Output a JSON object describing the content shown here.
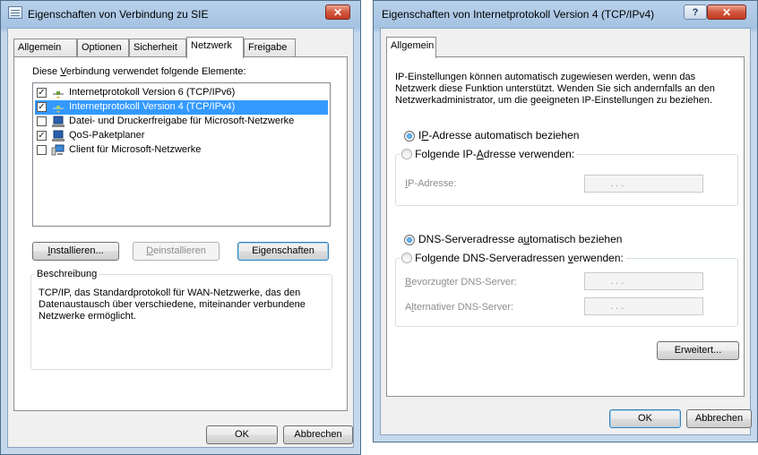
{
  "window1": {
    "title": "Eigenschaften von Verbindung zu  SIE",
    "close_glyph": "✕",
    "tabs": [
      "Allgemein",
      "Optionen",
      "Sicherheit",
      "Netzwerk",
      "Freigabe"
    ],
    "active_tab": "Netzwerk",
    "list_label_pre": "Diese ",
    "list_label_u": "V",
    "list_label_post": "erbindung verwendet folgende Elemente:",
    "items": [
      {
        "label": "Internetprotokoll Version 6 (TCP/IPv6)",
        "checked": true,
        "icon": "protocol-icon"
      },
      {
        "label": "Internetprotokoll Version 4 (TCP/IPv4)",
        "checked": true,
        "icon": "protocol-icon",
        "selected": true
      },
      {
        "label": "Datei- und Druckerfreigabe für Microsoft-Netzwerke",
        "checked": false,
        "icon": "service-icon"
      },
      {
        "label": "QoS-Paketplaner",
        "checked": true,
        "icon": "service-icon"
      },
      {
        "label": "Client für Microsoft-Netzwerke",
        "checked": false,
        "icon": "client-icon"
      }
    ],
    "install_u": "I",
    "install_rest": "nstallieren...",
    "uninstall_u": "D",
    "uninstall_rest": "einstallieren",
    "properties_label": "Eigenschaften",
    "description_title": "Beschreibung",
    "description_lines": [
      "TCP/IP, das Standardprotokoll für WAN-Netzwerke, das den",
      "Datenaustausch über verschiedene, miteinander verbundene",
      "Netzwerke ermöglicht."
    ],
    "ok_label": "OK",
    "cancel_label": "Abbrechen"
  },
  "window2": {
    "title": "Eigenschaften von Internetprotokoll Version 4 (TCP/IPv4)",
    "help_glyph": "?",
    "close_glyph": "✕",
    "tab": "Allgemein",
    "intro_lines": [
      "IP-Einstellungen können automatisch zugewiesen werden, wenn das",
      "Netzwerk diese Funktion unterstützt. Wenden Sie sich andernfalls an den",
      "Netzwerkadministrator, um die geeigneten IP-Einstellungen zu beziehen."
    ],
    "ip_auto_pre": "I",
    "ip_auto_u": "P",
    "ip_auto_post": "-Adresse automatisch beziehen",
    "ip_manual_pre": "Folgende IP-",
    "ip_manual_u": "A",
    "ip_manual_post": "dresse verwenden:",
    "ip_field_u": "I",
    "ip_field_rest": "P-Adresse:",
    "dns_auto_pre": "DNS-Serveradresse a",
    "dns_auto_u": "u",
    "dns_auto_post": "tomatisch beziehen",
    "dns_manual_pre": "Folgende DNS-Serveradressen ",
    "dns_manual_u": "v",
    "dns_manual_post": "erwenden:",
    "dns_pref_u": "B",
    "dns_pref_rest": "evorzugter DNS-Server:",
    "dns_alt_pre": "A",
    "dns_alt_u": "l",
    "dns_alt_post": "ternativer DNS-Server:",
    "ip_dots": ".      .      .",
    "advanced_label": "Erweitert...",
    "ok_label": "OK",
    "cancel_label": "Abbrechen"
  }
}
